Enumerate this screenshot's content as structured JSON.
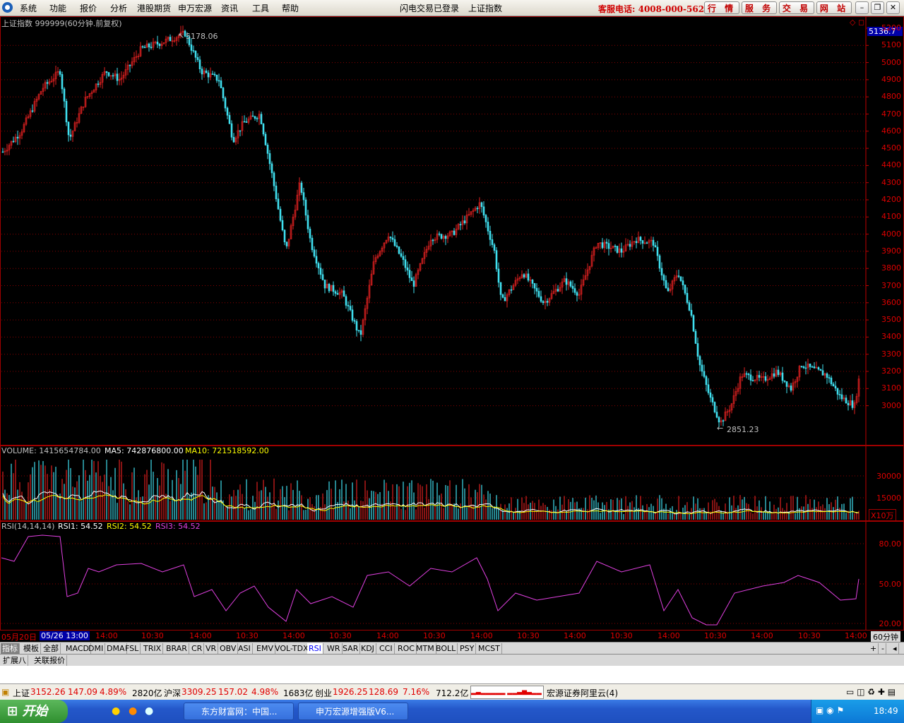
{
  "menu": {
    "items": [
      "系统",
      "功能",
      "报价",
      "分析",
      "港股期货",
      "申万宏源",
      "资讯",
      "工具",
      "帮助"
    ],
    "status_text": "闪电交易已登录",
    "index_name": "上证指数",
    "hotline": "客服电话: 4008-000-562",
    "buttons": [
      "行 情",
      "服 务",
      "交 易",
      "网 站"
    ]
  },
  "main_chart": {
    "title": "上证指数 999999(60分钟.前复权)",
    "high_label": "5178.06",
    "low_label": "2851.23",
    "current_price_tag": "5136.7",
    "y_labels": [
      "5200",
      "5100",
      "5000",
      "4900",
      "4800",
      "4700",
      "4600",
      "4500",
      "4400",
      "4300",
      "4200",
      "4100",
      "4000",
      "3900",
      "3800",
      "3700",
      "3600",
      "3500",
      "3400",
      "3300",
      "3200",
      "3100",
      "3000"
    ]
  },
  "volume": {
    "label": "VOLUME: 1415654784.00",
    "ma5": "MA5: 742876800.00",
    "ma10": "MA10: 721518592.00",
    "y_labels": [
      "30000",
      "15000"
    ],
    "unit": "X10万"
  },
  "rsi": {
    "label": "RSI(14,14,14)",
    "rsi1": "RSI1: 54.52",
    "rsi2": "RSI2: 54.52",
    "rsi3": "RSI3: 54.52",
    "y_labels": [
      "80.00",
      "50.00",
      "20.00"
    ]
  },
  "time_axis": {
    "start": "05月20日",
    "cursor": "05/26 13:00",
    "labels": [
      "14:00",
      "10:30",
      "14:00",
      "10:30",
      "14:00",
      "10:30",
      "14:00",
      "10:30",
      "14:00",
      "10:30",
      "14:00",
      "10:30",
      "14:00",
      "10:30",
      "14:00",
      "10:30",
      "14:00"
    ],
    "period": "60分钟"
  },
  "indicator_tabs": [
    "指标",
    "模板",
    "全部",
    "MACD",
    "DMI",
    "DMA",
    "FSL",
    "TRIX",
    "BRAR",
    "CR",
    "VR",
    "OBV",
    "ASI",
    "EMV",
    "VOL-TDX",
    "RSI",
    "WR",
    "SAR",
    "KDJ",
    "CCI",
    "ROC",
    "MTM",
    "BOLL",
    "PSY",
    "MCST"
  ],
  "ext_tabs": [
    "扩展八",
    "关联报价"
  ],
  "status_bar": {
    "sh_name": "上证",
    "sh_price": "3152.26",
    "sh_change": "147.09",
    "sh_pct": "4.89%",
    "sh_amount": "2820亿",
    "hs_name": "沪深",
    "hs_price": "3309.25",
    "hs_change": "157.02",
    "hs_pct": "4.98%",
    "hs_amount": "1683亿",
    "cy_name": "创业",
    "cy_price": "1926.25",
    "cy_change": "128.69",
    "cy_pct": "7.16%",
    "cy_amount": "712.2亿",
    "broker": "宏源证券阿里云(4)"
  },
  "taskbar": {
    "start": "开始",
    "items": [
      "东方财富网：中国...",
      "申万宏源增强版V6..."
    ],
    "clock": "18:49"
  },
  "colors": {
    "up": "#e02020",
    "down": "#40e0f0",
    "grid": "#8a0000",
    "rsi": "#e040e0",
    "ma5": "#ffffff",
    "ma10": "#ffff00"
  }
}
